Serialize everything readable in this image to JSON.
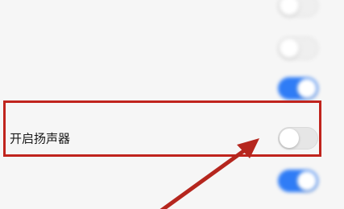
{
  "settings": {
    "rows": [
      {
        "label": "",
        "toggle_state": "off",
        "blurred": true
      },
      {
        "label": "",
        "toggle_state": "off",
        "blurred": true
      },
      {
        "label": "",
        "toggle_state": "on",
        "blurred": true
      },
      {
        "label": "开启扬声器",
        "toggle_state": "off",
        "blurred": false
      },
      {
        "label": "",
        "toggle_state": "on",
        "blurred": true
      }
    ]
  },
  "annotation": {
    "box_color": "#c0241d",
    "arrow_color": "#b5261e"
  },
  "colors": {
    "toggle_on": "#2f7cf6",
    "toggle_off": "#e6e6e6",
    "background": "#f6f6f6"
  }
}
